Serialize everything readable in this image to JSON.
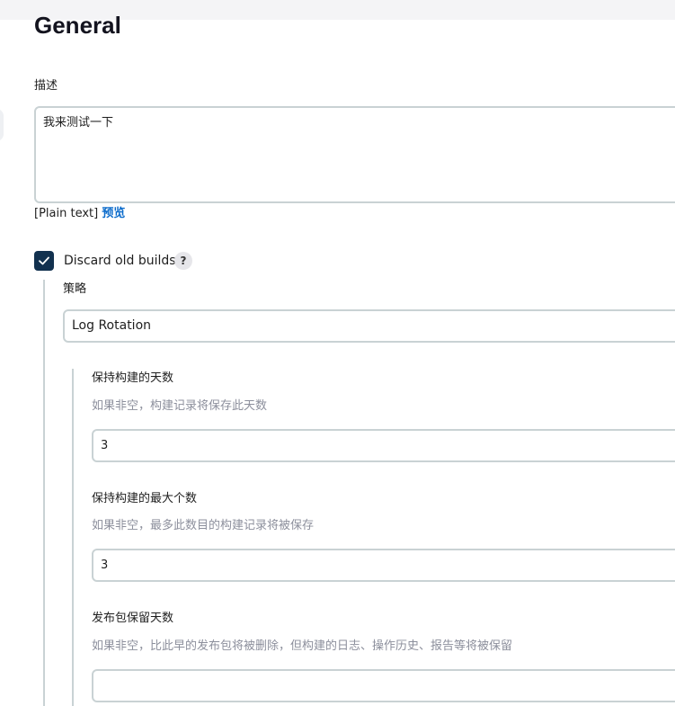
{
  "section": {
    "title": "General"
  },
  "description": {
    "label": "描述",
    "value": "我来测试一下",
    "format_note": "[Plain text]",
    "preview_link": "预览"
  },
  "discard_old_builds": {
    "checked": true,
    "label": "Discard old builds",
    "help_icon": "?"
  },
  "strategy": {
    "label": "策略",
    "selected": "Log Rotation"
  },
  "fields": [
    {
      "label": "保持构建的天数",
      "help": "如果非空，构建记录将保存此天数",
      "value": "3"
    },
    {
      "label": "保持构建的最大个数",
      "help": "如果非空，最多此数目的构建记录将被保存",
      "value": "3"
    },
    {
      "label": "发布包保留天数",
      "help": "如果非空，比此早的发布包将被删除，但构建的日志、操作历史、报告等将被保留",
      "value": ""
    }
  ],
  "colors": {
    "checkbox_bg": "#12314f",
    "link": "#0b6bcb",
    "border": "#c9d2d4",
    "help_text": "#8c8f9c"
  }
}
